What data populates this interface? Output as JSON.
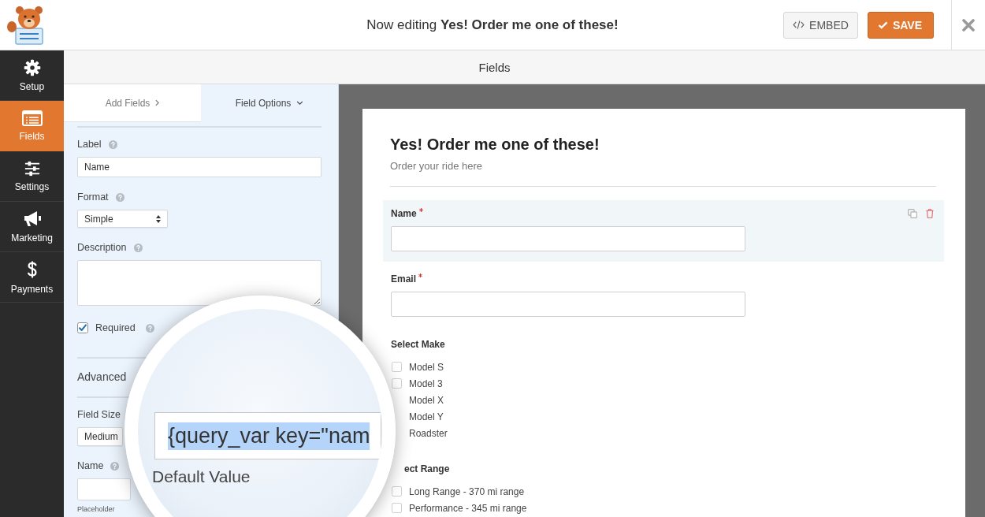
{
  "header": {
    "title": "Now editing **Yes! Order me one of these!**",
    "buttons": [
      {
        "kind": "embed",
        "label": "EMBED"
      },
      {
        "kind": "save",
        "label": "SAVE"
      }
    ]
  },
  "sidebar": {
    "items": [
      {
        "label": "Setup",
        "selected": false
      },
      {
        "label": "Fields",
        "selected": true
      },
      {
        "label": "Settings",
        "selected": false
      },
      {
        "label": "Marketing",
        "selected": false
      },
      {
        "label": "Payments",
        "selected": false
      }
    ]
  },
  "section_bar": {
    "title": "Fields"
  },
  "panel": {
    "tabs": [
      {
        "label": "Add Fields",
        "selected": false
      },
      {
        "label": "Field Options",
        "selected": true
      }
    ],
    "options": [
      {
        "kind": "input",
        "label": "Label",
        "help": true,
        "value": "Name"
      },
      {
        "kind": "select",
        "label": "Format",
        "help": true,
        "value": "Simple"
      },
      {
        "kind": "textarea",
        "label": "Description",
        "help": true
      },
      {
        "kind": "checkbox",
        "label": "Required",
        "help": true,
        "checked": true
      }
    ],
    "advanced": {
      "title": "Advanced",
      "options": [
        {
          "kind": "select",
          "label": "Field Size",
          "help": false,
          "value": "Medium"
        },
        {
          "kind": "input",
          "label": "Name",
          "help": true,
          "sublabel": "Placeholder"
        }
      ]
    }
  },
  "magnifier": {
    "value": "{query_var key=\"nam",
    "highlighted": true,
    "label": "Default Value"
  },
  "form": {
    "title": "Yes! Order me one of these!",
    "description": "Order your ride here",
    "fields": [
      {
        "kind": "text",
        "label": "Name",
        "required": true,
        "selected": true
      },
      {
        "kind": "text",
        "label": "Email",
        "required": true,
        "selected": false
      },
      {
        "kind": "checkboxes",
        "label": "Select Make",
        "required": false,
        "selected": false,
        "options": [
          {
            "kind": "checkbox",
            "label": "Model S",
            "checked": false
          },
          {
            "kind": "checkbox",
            "label": "Model 3",
            "checked": false
          },
          {
            "kind": "text",
            "label": "Model X"
          },
          {
            "kind": "text",
            "label": "Model Y"
          },
          {
            "kind": "text",
            "label": "Roadster"
          }
        ]
      },
      {
        "kind": "checkboxes",
        "label": "ect Range",
        "required": false,
        "selected": false,
        "options": [
          {
            "kind": "checkbox",
            "label": "Long Range - 370 mi range",
            "checked": false
          },
          {
            "kind": "checkbox",
            "label": "Performance - 345 mi range",
            "checked": false
          }
        ]
      }
    ]
  }
}
